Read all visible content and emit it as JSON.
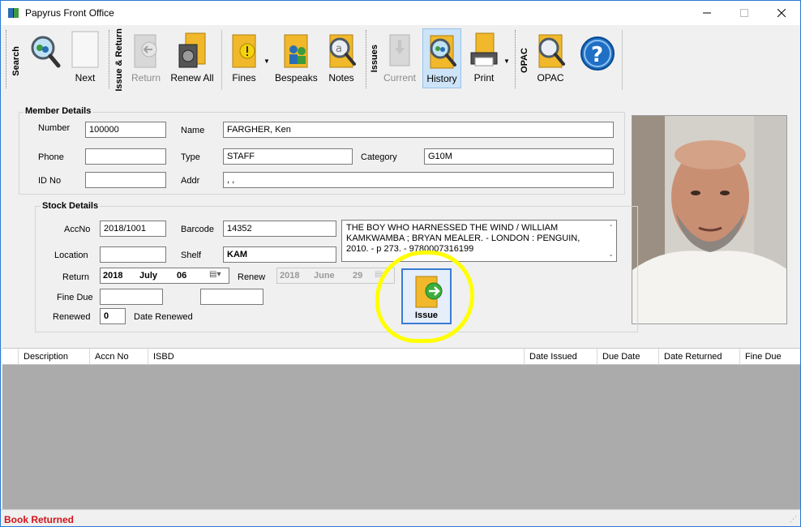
{
  "window": {
    "title": "Papyrus Front Office"
  },
  "toolbar": {
    "groups": {
      "search": "Search",
      "issue_return": "Issue & Return",
      "issues": "Issues",
      "opac": "OPAC"
    },
    "buttons": {
      "next": "Next",
      "return": "Return",
      "renew_all": "Renew All",
      "fines": "Fines",
      "bespeaks": "Bespeaks",
      "notes": "Notes",
      "current": "Current",
      "history": "History",
      "print": "Print",
      "opac": "OPAC"
    }
  },
  "member": {
    "legend": "Member Details",
    "labels": {
      "number": "Number",
      "name": "Name",
      "phone": "Phone",
      "type": "Type",
      "category": "Category",
      "idno": "ID No",
      "addr": "Addr"
    },
    "values": {
      "number": "100000",
      "name": "FARGHER, Ken",
      "phone": "",
      "type": "STAFF",
      "category": "G10M",
      "idno": "",
      "addr": ", ,"
    }
  },
  "stock": {
    "legend": "Stock Details",
    "labels": {
      "accno": "AccNo",
      "barcode": "Barcode",
      "location": "Location",
      "shelf": "Shelf",
      "return": "Return",
      "renew": "Renew",
      "fine_due": "Fine Due",
      "renewed": "Renewed",
      "date_renewed": "Date Renewed"
    },
    "values": {
      "accno": "2018/1001",
      "barcode": "14352",
      "location": "",
      "shelf": "KAM",
      "fine_due": "",
      "date_renewed": "",
      "renewed": "0",
      "isbd": "THE BOY WHO HARNESSED THE WIND / WILLIAM KAMKWAMBA ; BRYAN MEALER. - LONDON : PENGUIN, 2010. - p 273. - 9780007316199"
    },
    "return_date": {
      "year": "2018",
      "month": "July",
      "day": "06"
    },
    "renew_date": {
      "year": "2018",
      "month": "June",
      "day": "29"
    },
    "issue_button": "Issue"
  },
  "grid": {
    "columns": [
      "Description",
      "Accn No",
      "ISBD",
      "Date Issued",
      "Due Date",
      "Date Returned",
      "Fine Due"
    ]
  },
  "status": {
    "message": "Book Returned",
    "color": "#d0141a"
  },
  "colors": {
    "window_border": "#2b79d1",
    "highlight": "#ffff00",
    "grid_body": "#ababab"
  }
}
